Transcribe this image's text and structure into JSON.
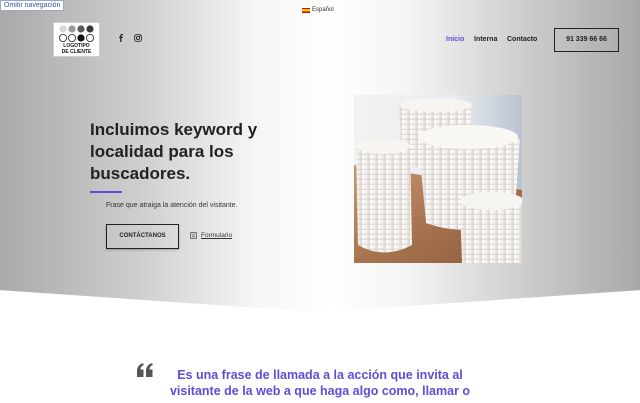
{
  "skip_link": "Omitir navegación",
  "language": {
    "label": "Español",
    "flag": "spain-flag-icon"
  },
  "logo": {
    "text": "LOGOTIPO\nDE CLIENTE"
  },
  "social": [
    {
      "icon": "facebook-icon"
    },
    {
      "icon": "instagram-icon"
    }
  ],
  "nav": {
    "items": [
      {
        "label": "Inicio",
        "active": true
      },
      {
        "label": "Interna",
        "active": false
      },
      {
        "label": "Contacto",
        "active": false
      }
    ],
    "phone": "91 339 66 66"
  },
  "hero": {
    "title": "Incluimos keyword y localidad para los buscadores.",
    "subtitle": "Frase que atraiga la atención del visitante.",
    "cta_label": "CONTÁCTANOS",
    "form_link": "Formulario"
  },
  "quote": {
    "text": "Es una frase de llamada a la acción que invita al visitante de la web a que haga algo como, llamar o"
  },
  "colors": {
    "accent": "#5a4fd6",
    "text": "#222222"
  }
}
